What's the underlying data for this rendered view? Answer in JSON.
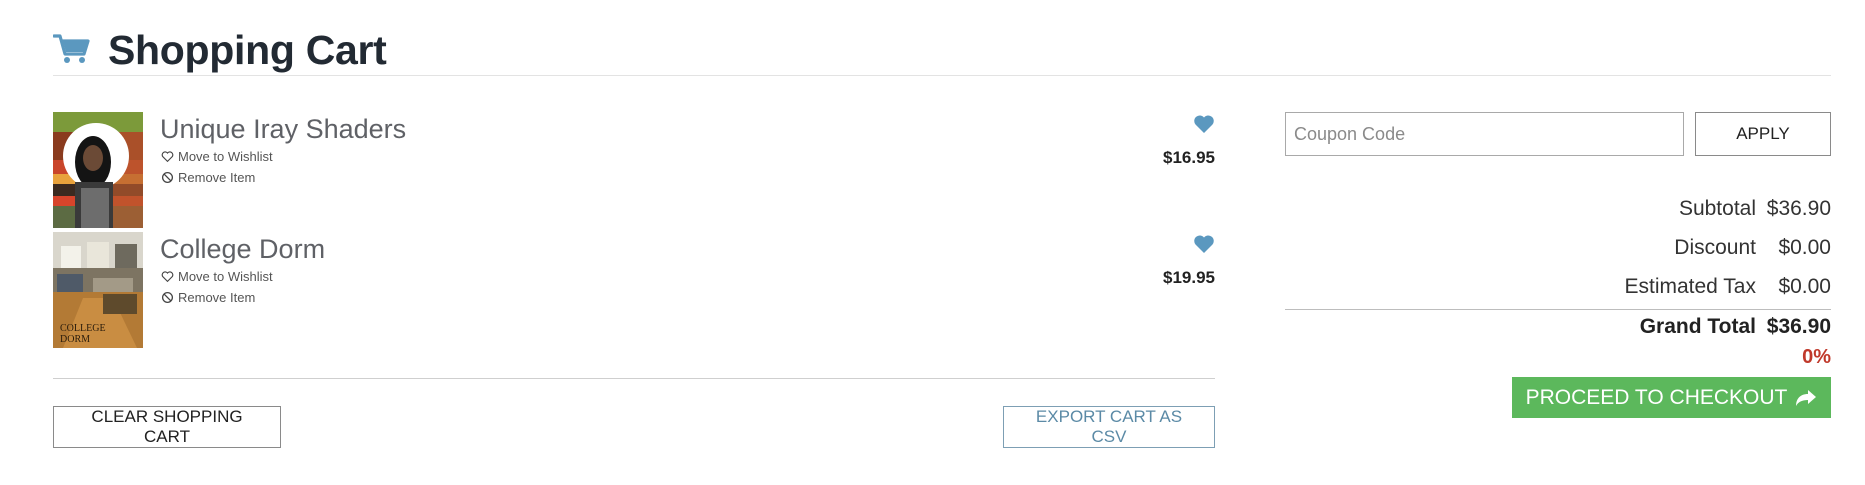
{
  "header": {
    "title": "Shopping Cart",
    "icon": "shopping-cart-icon"
  },
  "colors": {
    "accent_blue": "#5b98bf",
    "checkout_green": "#5cb85c",
    "discount_red": "#c0392b"
  },
  "cart": {
    "items": [
      {
        "name": "Unique Iray Shaders",
        "wishlist_label": "Move to Wishlist",
        "remove_label": "Remove Item",
        "price": "$16.95"
      },
      {
        "name": "College Dorm",
        "wishlist_label": "Move to Wishlist",
        "remove_label": "Remove Item",
        "price": "$19.95",
        "thumb_caption_line1": "COLLEGE",
        "thumb_caption_line2": "DORM"
      }
    ],
    "clear_label": "CLEAR SHOPPING CART",
    "export_label": "EXPORT CART AS CSV"
  },
  "summary": {
    "coupon_placeholder": "Coupon Code",
    "apply_label": "APPLY",
    "subtotal_label": "Subtotal",
    "subtotal_value": "$36.90",
    "discount_label": "Discount",
    "discount_value": "$0.00",
    "tax_label": "Estimated Tax",
    "tax_value": "$0.00",
    "grand_total_label": "Grand Total",
    "grand_total_value": "$36.90",
    "discount_percent": "0%",
    "checkout_label": "PROCEED TO CHECKOUT"
  }
}
